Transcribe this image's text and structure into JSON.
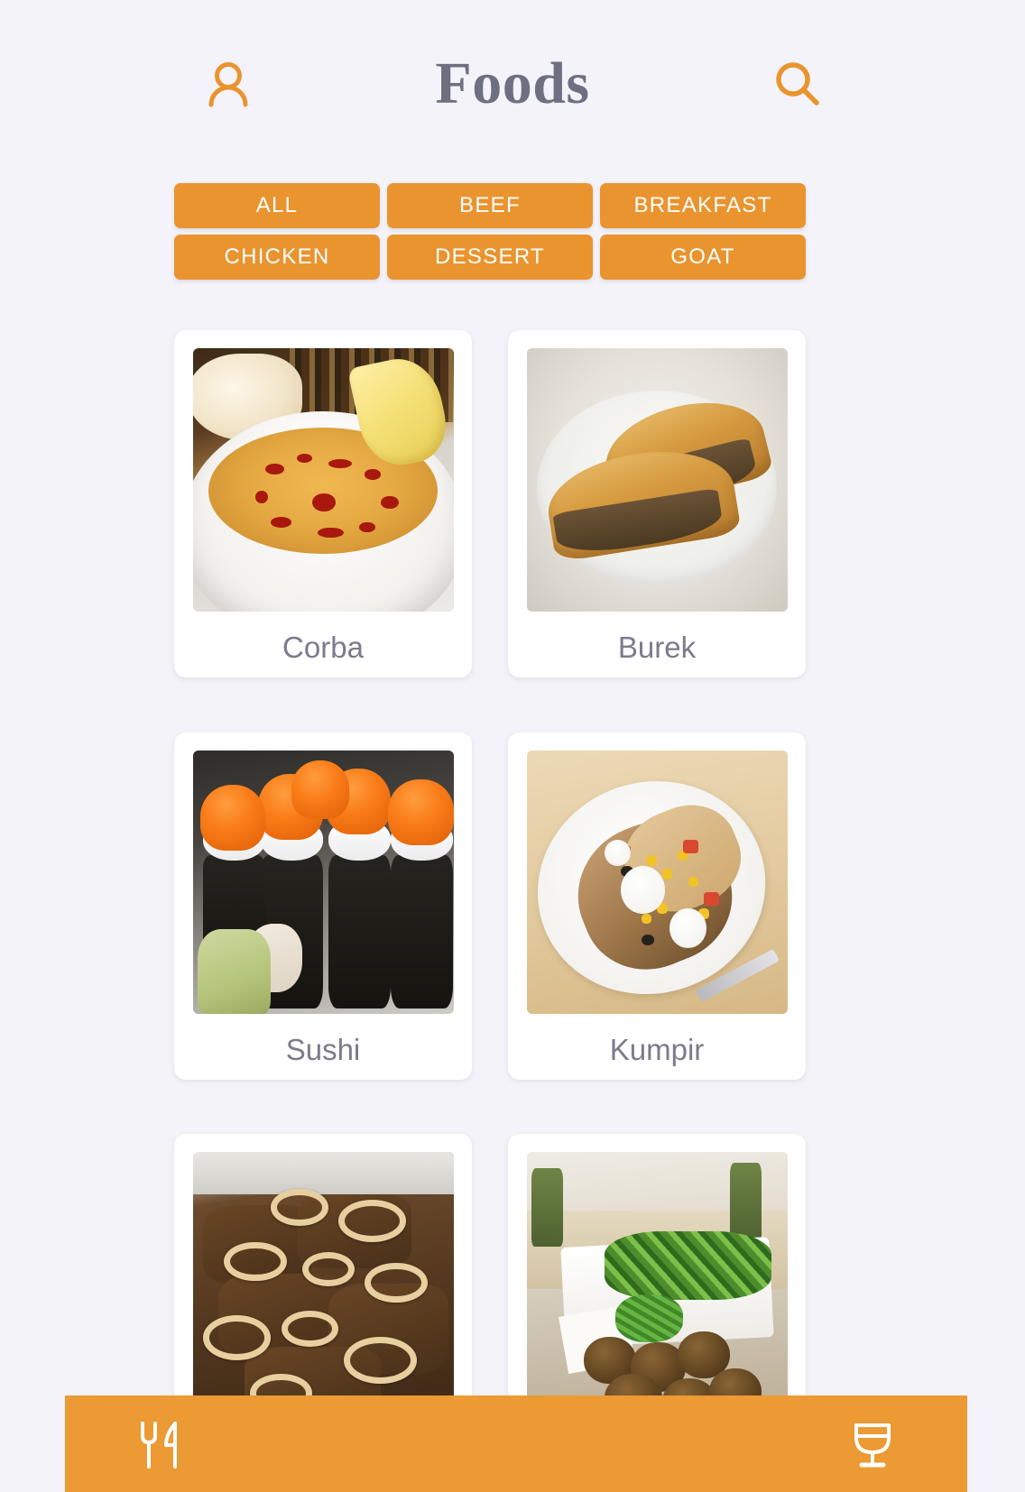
{
  "header": {
    "title": "Foods",
    "profile_icon": "person-icon",
    "search_icon": "search-icon",
    "accent_color": "#e9942f",
    "title_color": "#6f6f82"
  },
  "categories": [
    {
      "label": "ALL"
    },
    {
      "label": "BEEF"
    },
    {
      "label": "BREAKFAST"
    },
    {
      "label": "CHICKEN"
    },
    {
      "label": "DESSERT"
    },
    {
      "label": "GOAT"
    }
  ],
  "foods": [
    {
      "name": "Corba",
      "image": "lentil-soup-with-bread-and-lemon"
    },
    {
      "name": "Burek",
      "image": "meat-filled-pastry-on-plate"
    },
    {
      "name": "Sushi",
      "image": "tobiko-maki-rolls-with-wasabi"
    },
    {
      "name": "Kumpir",
      "image": "baked-potato-with-toppings"
    },
    {
      "name": "",
      "image": "beef-with-fried-onions"
    },
    {
      "name": "",
      "image": "falafel-with-salad"
    }
  ],
  "bottom_nav": {
    "background_color": "#ec9a33",
    "left_icon": "fork-knife-icon",
    "right_icon": "wine-glass-icon"
  },
  "page": {
    "background_color": "#f4f3f9"
  }
}
